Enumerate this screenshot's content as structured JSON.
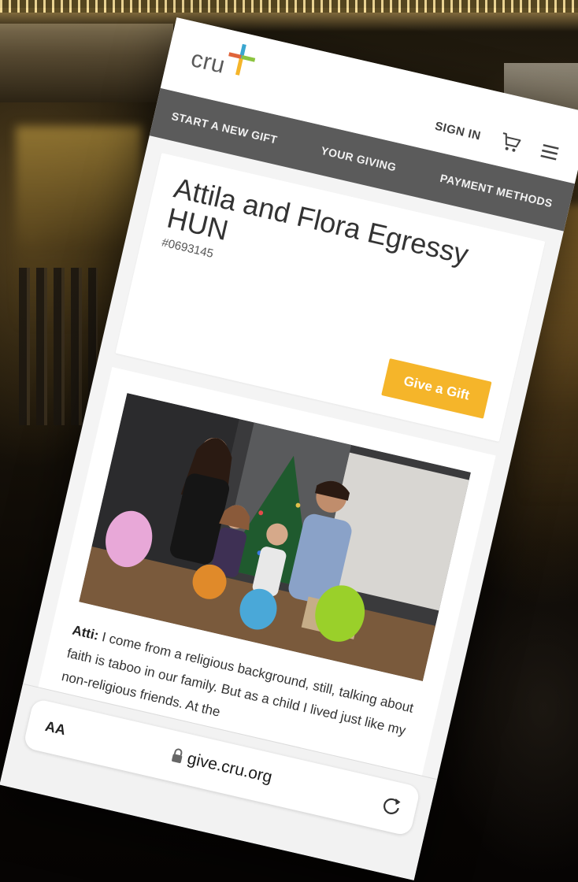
{
  "header": {
    "logo_text": "cru",
    "sign_in_label": "SIGN IN",
    "logo_colors": [
      "#f5b52a",
      "#3aa6d0",
      "#e0643a",
      "#8cc43f"
    ]
  },
  "nav": {
    "items": [
      "START A NEW GIFT",
      "YOUR GIVING",
      "PAYMENT METHODS"
    ]
  },
  "profile": {
    "name": "Attila and Flora Egressy HUN",
    "id": "#0693145",
    "give_label": "Give a Gift"
  },
  "story": {
    "speaker": "Atti:",
    "text": "I come from a religious background, still, talking about faith is taboo in our family. But as a child I lived just like my non-religious friends. At the"
  },
  "browser": {
    "text_size_label": "AA",
    "url": "give.cru.org"
  },
  "colors": {
    "nav_bg": "#5b5b5b",
    "accent": "#f5b52a"
  }
}
